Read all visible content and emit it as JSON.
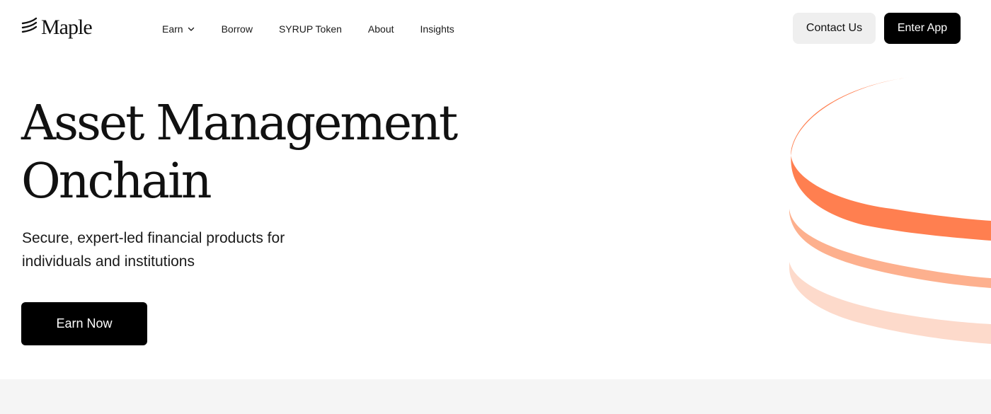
{
  "brand": {
    "name": "Maple",
    "logo_icon": "maple-stack-icon"
  },
  "nav": {
    "items": [
      {
        "label": "Earn",
        "icon": "chevron-down-icon"
      },
      {
        "label": "Borrow"
      },
      {
        "label": "SYRUP Token"
      },
      {
        "label": "About"
      },
      {
        "label": "Insights"
      }
    ]
  },
  "header": {
    "contact_label": "Contact Us",
    "enter_label": "Enter App"
  },
  "hero": {
    "title_line1": "Asset Management",
    "title_line2": "Onchain",
    "subtitle": "Secure, expert-led financial products for individuals and institutions",
    "cta_label": "Earn Now"
  },
  "colors": {
    "accent": "#FF7F50",
    "accent_mid": "#FDB08E",
    "accent_light": "#FDDACB",
    "primary_button": "#000000",
    "secondary_button": "#EFEFEF",
    "band": "#F5F5F5"
  }
}
